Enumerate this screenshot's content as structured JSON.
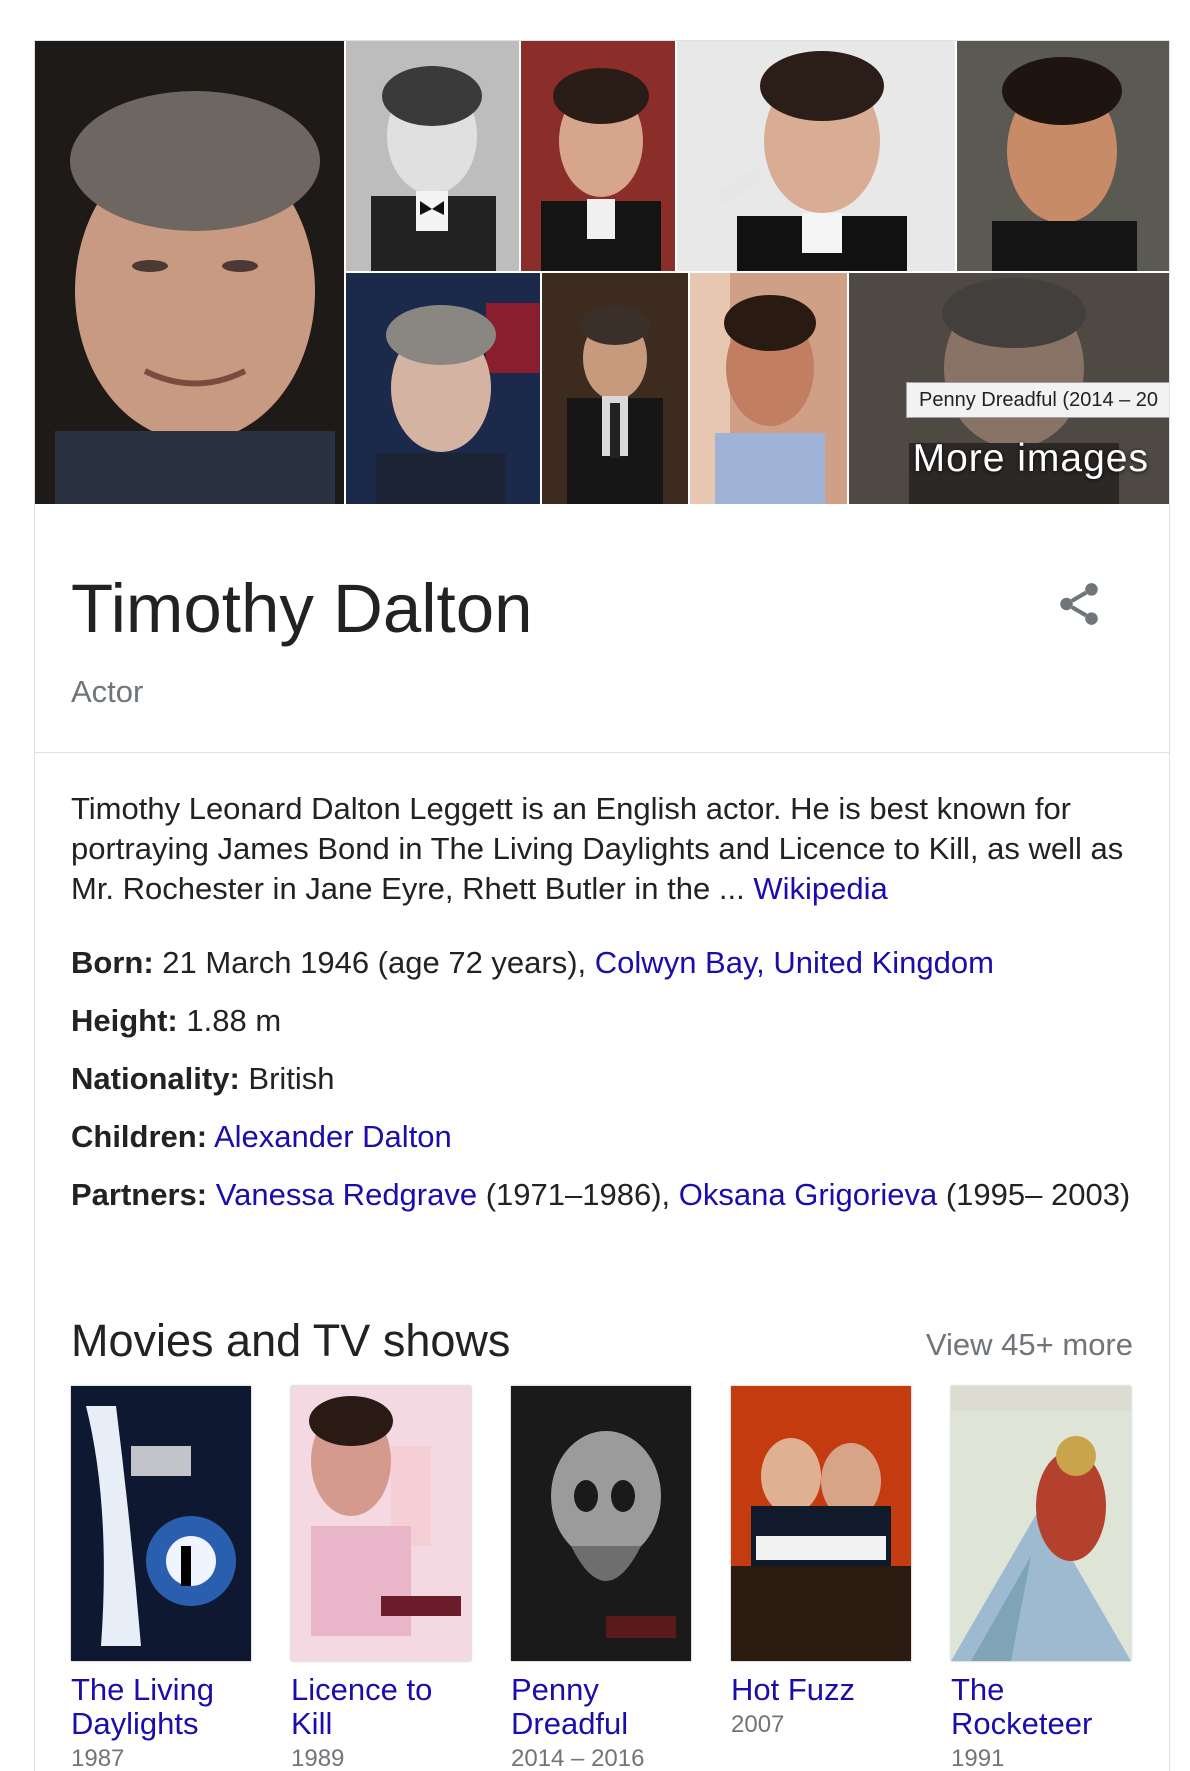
{
  "tooltip": "Penny Dreadful (2014 – 20",
  "more_images": "More images",
  "header": {
    "title": "Timothy Dalton",
    "subtitle": "Actor"
  },
  "description": {
    "text": "Timothy Leonard Dalton Leggett is an English actor. He is best known for portraying James Bond in The Living Daylights and Licence to Kill, as well as Mr. Rochester in Jane Eyre, Rhett Butler in the ... ",
    "source": "Wikipedia"
  },
  "facts": {
    "born": {
      "label": "Born:",
      "value": " 21 March 1946 (age 72 years), ",
      "link": "Colwyn Bay, United Kingdom"
    },
    "height": {
      "label": "Height:",
      "value": " 1.88 m"
    },
    "nationality": {
      "label": "Nationality:",
      "value": " British"
    },
    "children": {
      "label": "Children:",
      "link": "Alexander Dalton"
    },
    "partners": {
      "label": "Partners:",
      "link1": "Vanessa Redgrave",
      "text1": " (1971–1986), ",
      "link2": "Oksana Grigorieva",
      "text2": " (1995– 2003)"
    }
  },
  "movies_section": {
    "title": "Movies and TV shows",
    "view_more": "View 45+ more",
    "items": [
      {
        "title": "The Living Daylights",
        "year": "1987"
      },
      {
        "title": "Licence to Kill",
        "year": "1989"
      },
      {
        "title": "Penny Dreadful",
        "year": "2014 – 2016"
      },
      {
        "title": "Hot Fuzz",
        "year": "2007"
      },
      {
        "title": "The Rocketeer",
        "year": "1991"
      }
    ]
  },
  "colors": {
    "link": "#1a0dab",
    "muted": "#70757a",
    "text": "#222222",
    "border": "#dfe1e5"
  },
  "icons": [
    "share-icon"
  ]
}
